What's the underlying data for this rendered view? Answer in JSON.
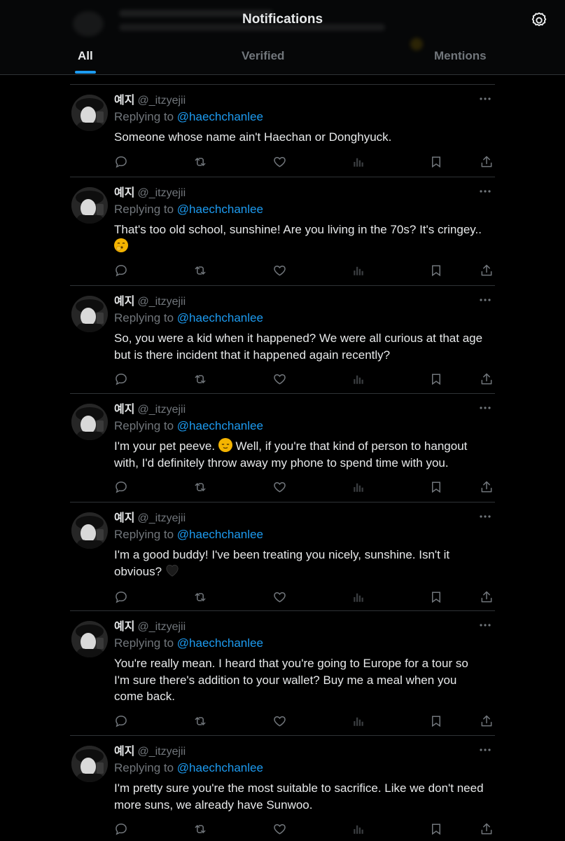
{
  "header": {
    "title": "Notifications",
    "tabs": [
      {
        "label": "All",
        "active": true
      },
      {
        "label": "Verified",
        "active": false
      },
      {
        "label": "Mentions",
        "active": false
      }
    ]
  },
  "colors": {
    "accent": "#1d9bf0",
    "background": "#000000",
    "secondary_text": "#71767b",
    "primary_text": "#e7e9ea"
  },
  "icons": {
    "settings": "gear-icon",
    "more": "more-icon",
    "reply": "reply-icon",
    "repost": "repost-icon",
    "like": "heart-icon",
    "views": "views-icon",
    "bookmark": "bookmark-icon",
    "share": "share-icon"
  },
  "tweets": [
    {
      "name": "예지",
      "handle": "@_itzyejii",
      "replying_prefix": "Replying to",
      "replying_to": "@haechchanlee",
      "text": "Someone whose name ain't Haechan or Donghyuck."
    },
    {
      "name": "예지",
      "handle": "@_itzyejii",
      "replying_prefix": "Replying to",
      "replying_to": "@haechchanlee",
      "text": "That's too old school, sunshine! Are you living in the 70s? It's cringey..",
      "emoji": "kissing-face-emoji"
    },
    {
      "name": "예지",
      "handle": "@_itzyejii",
      "replying_prefix": "Replying to",
      "replying_to": "@haechchanlee",
      "text": "So, you were a kid when it happened? We were all curious at that age but is there incident that it happened again recently?"
    },
    {
      "name": "예지",
      "handle": "@_itzyejii",
      "replying_prefix": "Replying to",
      "replying_to": "@haechchanlee",
      "text_before": "I'm your pet peeve.",
      "emoji": "relieved-face-emoji",
      "text_after": "Well, if you're that kind of person to hangout with, I'd definitely throw away my phone to spend time with you."
    },
    {
      "name": "예지",
      "handle": "@_itzyejii",
      "replying_prefix": "Replying to",
      "replying_to": "@haechchanlee",
      "text": "I'm a good buddy! I've been treating you nicely, sunshine. Isn't it obvious?",
      "emoji": "black-heart-emoji"
    },
    {
      "name": "예지",
      "handle": "@_itzyejii",
      "replying_prefix": "Replying to",
      "replying_to": "@haechchanlee",
      "text": "You're really mean. I heard that you're going to Europe for a tour so I'm sure there's addition to your wallet? Buy me a meal when you come back."
    },
    {
      "name": "예지",
      "handle": "@_itzyejii",
      "replying_prefix": "Replying to",
      "replying_to": "@haechchanlee",
      "text": "I'm pretty sure you're the most suitable to sacrifice. Like we don't need more suns, we already have Sunwoo."
    }
  ]
}
